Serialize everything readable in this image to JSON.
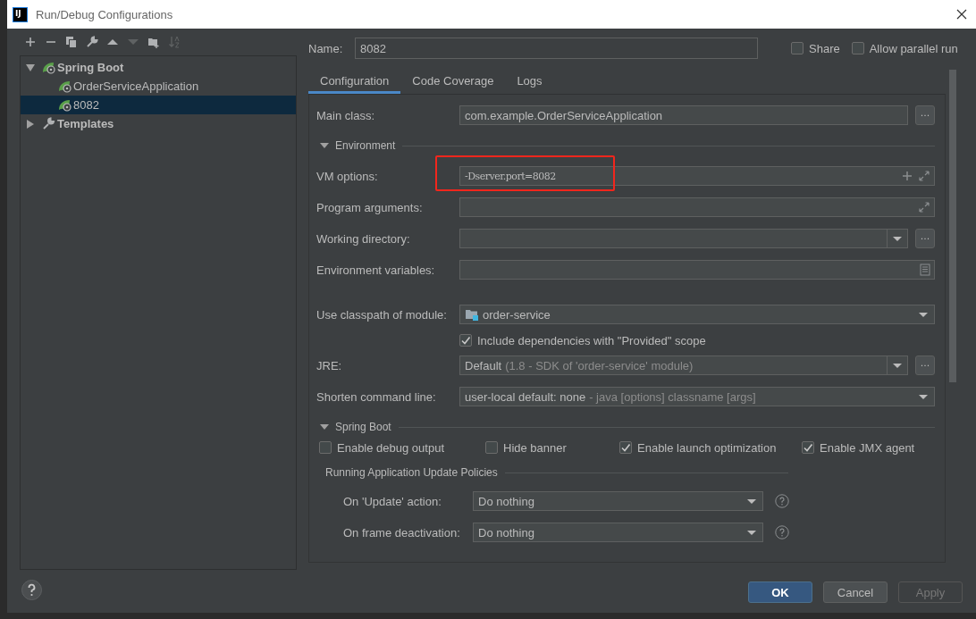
{
  "window": {
    "app_icon": "IJ",
    "title": "Run/Debug Configurations"
  },
  "toolbar": [
    {
      "kind": "add",
      "disabled": false
    },
    {
      "kind": "remove",
      "disabled": false
    },
    {
      "kind": "copy",
      "disabled": false
    },
    {
      "kind": "wrench",
      "disabled": false
    },
    {
      "kind": "up",
      "disabled": false
    },
    {
      "kind": "down",
      "disabled": true
    },
    {
      "kind": "folder",
      "disabled": false
    },
    {
      "kind": "sort",
      "disabled": true
    }
  ],
  "tree": [
    {
      "label": "Spring Boot",
      "kind": "spring",
      "bold": true,
      "expanded": true,
      "selected": false,
      "children": [
        {
          "label": "OrderServiceApplication",
          "kind": "spring",
          "bold": false,
          "selected": false
        },
        {
          "label": "8082",
          "kind": "spring",
          "bold": false,
          "selected": true
        }
      ]
    },
    {
      "label": "Templates",
      "kind": "wrench",
      "bold": true,
      "expanded": false,
      "selected": false
    }
  ],
  "name": {
    "label": "Name:",
    "value": "8082"
  },
  "share": {
    "label": "Share",
    "checked": false
  },
  "allow_parallel_run": {
    "label": "Allow parallel run",
    "checked": false
  },
  "tabs": [
    {
      "label": "Configuration",
      "selected": true
    },
    {
      "label": "Code Coverage",
      "selected": false
    },
    {
      "label": "Logs",
      "selected": false
    }
  ],
  "configuration": {
    "main_class": {
      "label": "Main class:",
      "value": "com.example.OrderServiceApplication",
      "browse_button": "..."
    },
    "environment": {
      "title": "Environment",
      "expanded": true,
      "vm_options": {
        "label": "VM options:",
        "value": "-Dserver.port=8082",
        "highlighted": true
      },
      "program_arguments": {
        "label": "Program arguments:"
      },
      "working_directory": {
        "label": "Working directory:",
        "browse_button": "..."
      },
      "environment_variables": {
        "label": "Environment variables:"
      }
    },
    "classpath_module": {
      "label": "Use classpath of module:",
      "value": "order-service"
    },
    "include_provided": {
      "label": "Include dependencies with \"Provided\" scope",
      "checked": true
    },
    "jre": {
      "label": "JRE:",
      "value": "Default",
      "detail": "(1.8 - SDK of 'order-service' module)",
      "browse_button": "..."
    },
    "shorten_command_line": {
      "label": "Shorten command line:",
      "value": "user-local default: none",
      "detail": "- java [options] classname [args]"
    },
    "spring_boot": {
      "title": "Spring Boot",
      "expanded": true,
      "options": [
        {
          "label": "Enable debug output",
          "checked": false
        },
        {
          "label": "Hide banner",
          "checked": false
        },
        {
          "label": "Enable launch optimization",
          "checked": true
        },
        {
          "label": "Enable JMX agent",
          "checked": true
        }
      ],
      "policies": {
        "title": "Running Application Update Policies",
        "rows": [
          {
            "label": "On 'Update' action:",
            "value": "Do nothing"
          },
          {
            "label": "On frame deactivation:",
            "value": "Do nothing"
          }
        ]
      }
    }
  },
  "buttons": [
    {
      "label": "OK",
      "kind": "default",
      "disabled": false
    },
    {
      "label": "Cancel",
      "kind": "normal",
      "disabled": false
    },
    {
      "label": "Apply",
      "kind": "normal",
      "disabled": true
    }
  ]
}
